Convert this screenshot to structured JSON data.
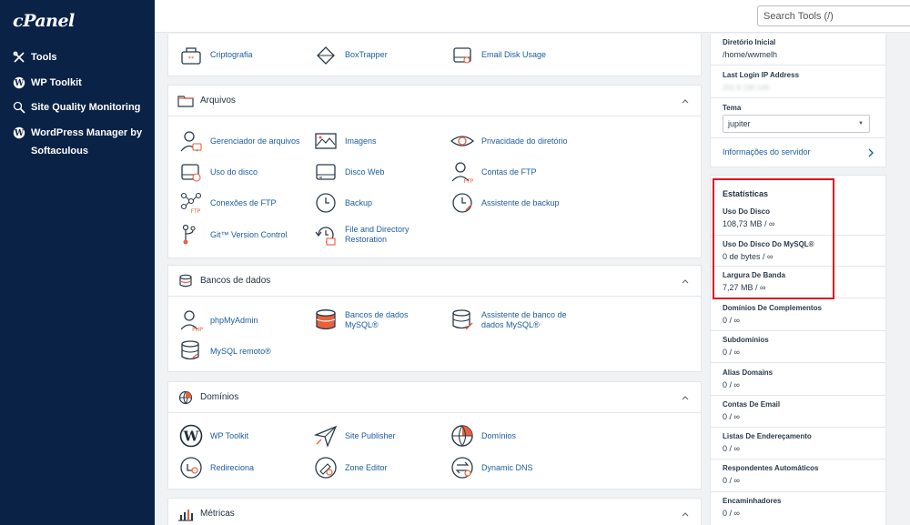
{
  "app": {
    "logo": "cPanel"
  },
  "sidebar": {
    "items": [
      {
        "label": "Tools",
        "icon": "tools-icon"
      },
      {
        "label": "WP Toolkit",
        "icon": "wordpress-icon"
      },
      {
        "label": "Site Quality Monitoring",
        "icon": "search-icon"
      },
      {
        "label": "WordPress Manager by Softaculous",
        "icon": "wordpress-icon"
      }
    ]
  },
  "header": {
    "search_placeholder": "Search Tools (/)"
  },
  "top_partial_items": [
    {
      "label": "Criptografia",
      "icon": "lock-icon"
    },
    {
      "label": "BoxTrapper",
      "icon": "boxtrapper-icon"
    },
    {
      "label": "Email Disk Usage",
      "icon": "disk-icon"
    }
  ],
  "sections": {
    "arquivos": {
      "title": "Arquivos",
      "items": [
        {
          "label": "Gerenciador de arquivos",
          "icon": "file-manager-icon"
        },
        {
          "label": "Imagens",
          "icon": "images-icon"
        },
        {
          "label": "Privacidade do diretório",
          "icon": "eye-icon"
        },
        {
          "label": "Uso do disco",
          "icon": "disk-usage-icon"
        },
        {
          "label": "Disco Web",
          "icon": "web-disk-icon"
        },
        {
          "label": "Contas de FTP",
          "icon": "ftp-account-icon"
        },
        {
          "label": "Conexões de FTP",
          "icon": "ftp-connections-icon"
        },
        {
          "label": "Backup",
          "icon": "backup-icon"
        },
        {
          "label": "Assistente de backup",
          "icon": "backup-wizard-icon"
        },
        {
          "label": "Git™ Version Control",
          "icon": "git-icon"
        },
        {
          "label": "File and Directory Restoration",
          "icon": "restore-icon"
        }
      ]
    },
    "bancos": {
      "title": "Bancos de dados",
      "items": [
        {
          "label": "phpMyAdmin",
          "icon": "phpmyadmin-icon"
        },
        {
          "label": "Bancos de dados MySQL®",
          "icon": "mysql-databases-icon"
        },
        {
          "label": "Assistente de banco de dados MySQL®",
          "icon": "mysql-wizard-icon"
        },
        {
          "label": "MySQL remoto®",
          "icon": "remote-mysql-icon"
        }
      ]
    },
    "dominios": {
      "title": "Domínios",
      "items": [
        {
          "label": "WP Toolkit",
          "icon": "wordpress-icon"
        },
        {
          "label": "Site Publisher",
          "icon": "site-publisher-icon"
        },
        {
          "label": "Domínios",
          "icon": "globe-icon"
        },
        {
          "label": "Redireciona",
          "icon": "redirect-icon"
        },
        {
          "label": "Zone Editor",
          "icon": "zone-editor-icon"
        },
        {
          "label": "Dynamic DNS",
          "icon": "dynamic-dns-icon"
        }
      ]
    },
    "metricas": {
      "title": "Métricas",
      "icon": "metrics-icon"
    }
  },
  "info": {
    "home_dir_label": "Diretório Inicial",
    "home_dir_value": "/home/wwmelh",
    "last_login_label": "Last Login IP Address",
    "last_login_value": "201.8.190.149",
    "theme_label": "Tema",
    "theme_value": "jupiter",
    "server_info_link": "Informações do servidor"
  },
  "stats": {
    "title": "Estatísticas",
    "items": [
      {
        "label": "Uso Do Disco",
        "value": "108,73 MB / ∞"
      },
      {
        "label": "Uso Do Disco Do MySQL®",
        "value": "0 de bytes / ∞"
      },
      {
        "label": "Largura De Banda",
        "value": "7,27 MB / ∞"
      },
      {
        "label": "Domínios De Complementos",
        "value": "0 / ∞"
      },
      {
        "label": "Subdomínios",
        "value": "0 / ∞"
      },
      {
        "label": "Alias Domains",
        "value": "0 / ∞"
      },
      {
        "label": "Contas De Email",
        "value": "0 / ∞"
      },
      {
        "label": "Listas De Endereçamento",
        "value": "0 / ∞"
      },
      {
        "label": "Respondentes Automáticos",
        "value": "0 / ∞"
      },
      {
        "label": "Encaminhadores",
        "value": "0 / ∞"
      }
    ]
  },
  "colors": {
    "sidebar_bg": "#0b2247",
    "link": "#1b5c9e",
    "accent_orange": "#e8613c",
    "highlight_red": "#e3141f"
  }
}
